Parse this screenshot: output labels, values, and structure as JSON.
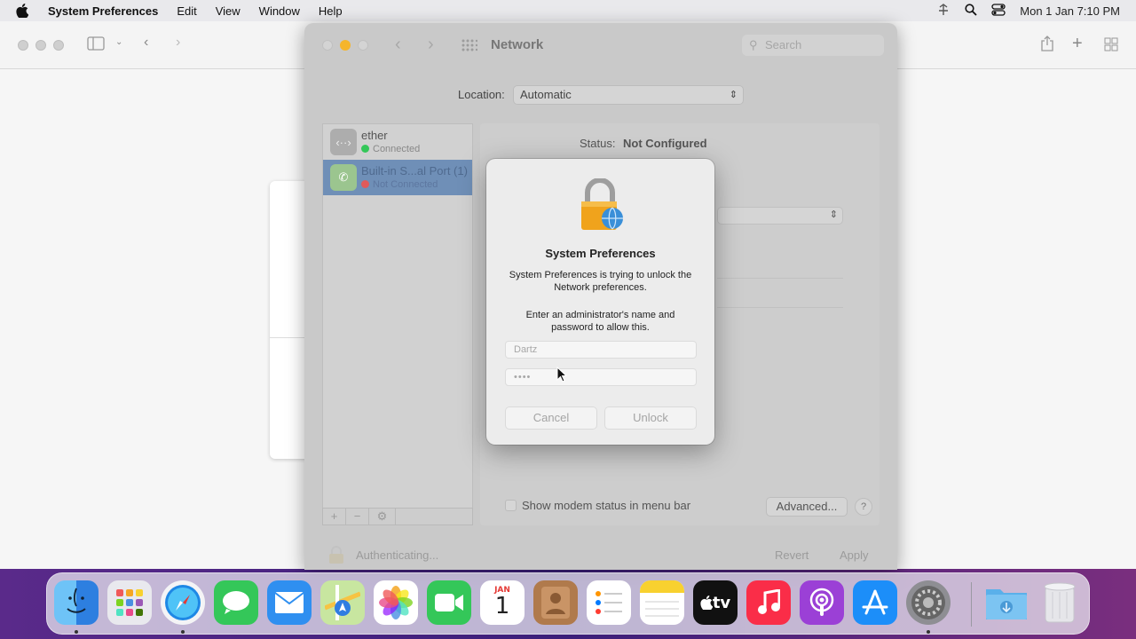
{
  "menubar": {
    "app_name": "System Preferences",
    "items": [
      "Edit",
      "View",
      "Window",
      "Help"
    ],
    "clock": "Mon 1 Jan  7:10 PM"
  },
  "network_window": {
    "title": "Network",
    "search_placeholder": "Search",
    "location_label": "Location:",
    "location_value": "Automatic",
    "services": [
      {
        "name": "ether",
        "status": "Connected",
        "status_color": "#34c759"
      },
      {
        "name": "Built-in S...al Port (1)",
        "status": "Not Connected",
        "status_color": "#ff3b30"
      }
    ],
    "status_label": "Status:",
    "status_value": "Not Configured",
    "show_modem_label": "Show modem status in menu bar",
    "advanced_label": "Advanced...",
    "help_label": "?",
    "authenticating_label": "Authenticating...",
    "revert_label": "Revert",
    "apply_label": "Apply"
  },
  "dialog": {
    "title": "System Preferences",
    "message1": "System Preferences is trying to unlock the Network preferences.",
    "message2": "Enter an administrator's name and password to allow this.",
    "username_value": "Dartz",
    "password_value": "••••",
    "cancel_label": "Cancel",
    "unlock_label": "Unlock"
  },
  "dock": {
    "calendar_month": "JAN",
    "calendar_day": "1",
    "tv_label": "tv",
    "apps": [
      "finder",
      "launchpad",
      "safari",
      "messages",
      "mail",
      "maps",
      "photos",
      "facetime",
      "calendar",
      "contacts",
      "reminders",
      "notes",
      "apple-tv",
      "music",
      "podcasts",
      "app-store",
      "system-preferences",
      "downloads",
      "trash"
    ]
  }
}
